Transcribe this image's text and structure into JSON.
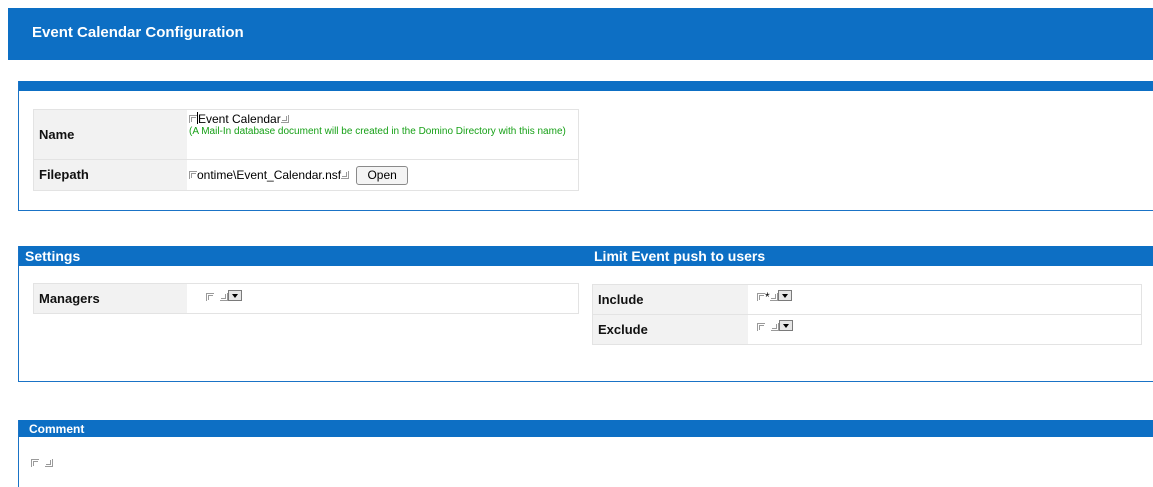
{
  "header": {
    "title": "Event Calendar Configuration"
  },
  "basics": {
    "name_label": "Name",
    "name_value": "Event Calendar",
    "name_hint": "(A Mail-In database document will be created in the Domino Directory with this name)",
    "filepath_label": "Filepath",
    "filepath_value": "ontime\\Event_Calendar.nsf",
    "open_button": "Open"
  },
  "settings": {
    "heading": "Settings",
    "managers_label": "Managers",
    "managers_value": ""
  },
  "limit_push": {
    "heading": "Limit Event push to users",
    "include_label": "Include",
    "include_value": "*",
    "exclude_label": "Exclude",
    "exclude_value": ""
  },
  "comment": {
    "heading": "Comment",
    "value": ""
  },
  "colors": {
    "accent": "#0d6fc4",
    "hint": "#16a016",
    "label_bg": "#f2f2f2"
  }
}
